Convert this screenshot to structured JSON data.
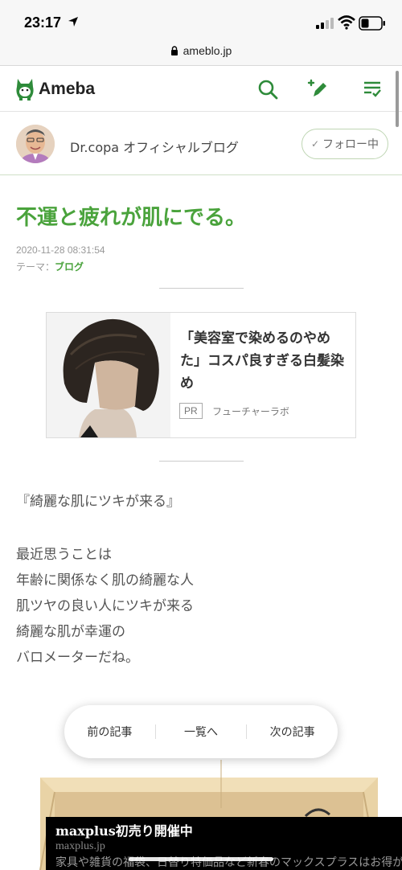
{
  "status_bar": {
    "time": "23:17"
  },
  "url_bar": {
    "url": "ameblo.jp"
  },
  "header": {
    "logo_text": "Ameba"
  },
  "blog": {
    "name": "Dr.copa オフィシャルブログ",
    "follow_label": "フォロー中"
  },
  "article": {
    "title": "不運と疲れが肌にでる。",
    "date": "2020-11-28 08:31:54",
    "theme_label": "テーマ：",
    "theme_value": "ブログ",
    "body_lines": [
      "『綺麗な肌にツキが来る』",
      "最近思うことは",
      "年齢に関係なく肌の綺麗な人",
      "肌ツヤの良い人にツキが来る",
      "綺麗な肌が幸運の",
      "バロメーターだね。"
    ]
  },
  "ad": {
    "title": "「美容室で染めるのやめた」コスパ良すぎる白髪染め",
    "badge": "PR",
    "sponsor": "フューチャーラボ"
  },
  "nav": {
    "prev": "前の記事",
    "list": "一覧へ",
    "next": "次の記事"
  },
  "banner": {
    "title": "maxplus初売り開催中",
    "domain": "maxplus.jp",
    "description": "家具や雑貨の福袋、日替り特価品など新春のマックスプラスはお得が目白押し！"
  },
  "colors": {
    "accent": "#4aa33c",
    "follow_border": "#bfd6b4"
  }
}
